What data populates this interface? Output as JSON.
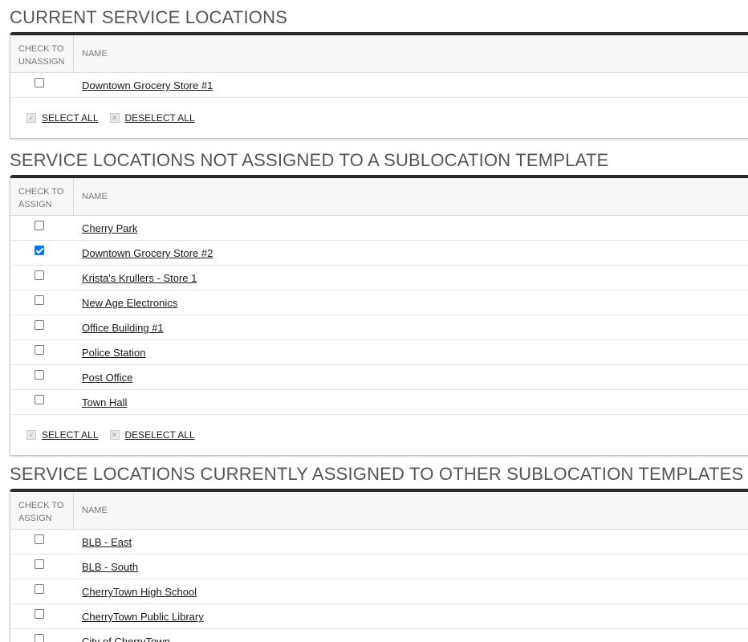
{
  "sections": [
    {
      "title": "CURRENT SERVICE LOCATIONS",
      "check_header": "CHECK TO\nUNASSIGN",
      "name_header": "NAME",
      "rows": [
        {
          "name": "Downtown Grocery Store #1",
          "checked": false
        }
      ],
      "select_all": "SELECT ALL",
      "deselect_all": "DESELECT ALL"
    },
    {
      "title": "SERVICE LOCATIONS NOT ASSIGNED TO A SUBLOCATION TEMPLATE",
      "check_header": "CHECK TO\nASSIGN",
      "name_header": "NAME",
      "rows": [
        {
          "name": "Cherry Park",
          "checked": false
        },
        {
          "name": "Downtown Grocery Store #2",
          "checked": true
        },
        {
          "name": "Krista's Krullers - Store 1",
          "checked": false
        },
        {
          "name": "New Age Electronics",
          "checked": false
        },
        {
          "name": "Office Building #1",
          "checked": false
        },
        {
          "name": "Police Station",
          "checked": false
        },
        {
          "name": "Post Office",
          "checked": false
        },
        {
          "name": "Town Hall",
          "checked": false
        }
      ],
      "select_all": "SELECT ALL",
      "deselect_all": "DESELECT ALL"
    },
    {
      "title": "SERVICE LOCATIONS CURRENTLY ASSIGNED TO OTHER SUBLOCATION TEMPLATES",
      "check_header": "CHECK TO\nASSIGN",
      "name_header": "NAME",
      "rows": [
        {
          "name": "BLB - East",
          "checked": false
        },
        {
          "name": "BLB - South",
          "checked": false
        },
        {
          "name": "CherryTown High School",
          "checked": false
        },
        {
          "name": "CherryTown Public Library",
          "checked": false
        },
        {
          "name": "City of CherryTown",
          "checked": false
        }
      ]
    }
  ],
  "icons": {
    "select_all": "checkmark-icon",
    "deselect_all": "x-icon"
  },
  "colors": {
    "accent": "#0075ff",
    "panel_top_border": "#2b2b2b",
    "title_text": "#555555"
  }
}
